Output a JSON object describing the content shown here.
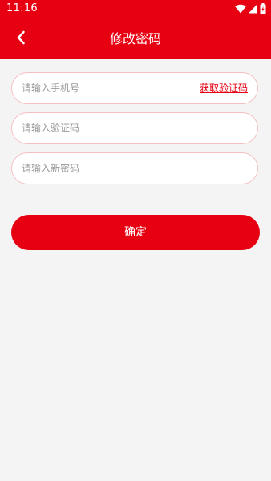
{
  "status_bar": {
    "time": "11:16",
    "icons": [
      "wifi-icon",
      "signal-icon",
      "battery-icon"
    ]
  },
  "header": {
    "back_icon": "chevron-left-icon",
    "title": "修改密码"
  },
  "form": {
    "phone": {
      "value": "",
      "placeholder": "请输入手机号"
    },
    "get_code_label": "获取验证码",
    "code": {
      "value": "",
      "placeholder": "请输入验证码"
    },
    "new_password": {
      "value": "",
      "placeholder": "请输入新密码"
    },
    "submit_label": "确定"
  },
  "colors": {
    "accent": "#e60012",
    "page_background": "#f4f4f4",
    "field_border": "#f6c0c3",
    "placeholder": "#9a9a9a"
  }
}
